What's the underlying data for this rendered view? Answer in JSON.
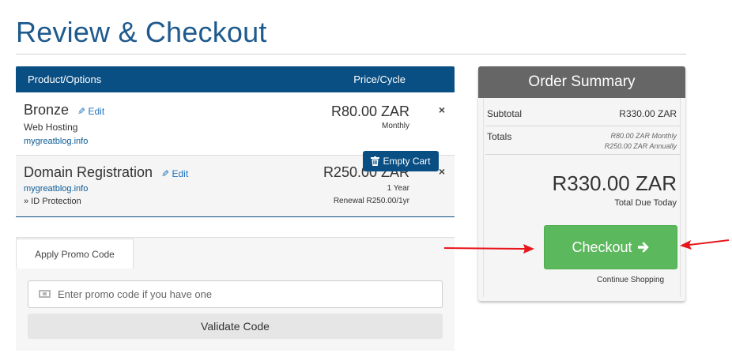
{
  "page_title": "Review & Checkout",
  "cart": {
    "header": {
      "product_col": "Product/Options",
      "price_col": "Price/Cycle"
    },
    "items": [
      {
        "name": "Bronze",
        "edit_label": "Edit",
        "subtitle": "Web Hosting",
        "domain": "mygreatblog.info",
        "price": "R80.00 ZAR",
        "cycle": "Monthly",
        "remove_label": "×"
      },
      {
        "name": "Domain Registration",
        "edit_label": "Edit",
        "domain": "mygreatblog.info",
        "option": "» ID Protection",
        "price": "R250.00 ZAR",
        "cycle": "1 Year",
        "renewal": "Renewal R250.00/1yr",
        "remove_label": "×"
      }
    ],
    "empty_cart_label": "Empty Cart"
  },
  "promo": {
    "tab_label": "Apply Promo Code",
    "input_placeholder": "Enter promo code if you have one",
    "input_value": "",
    "validate_label": "Validate Code"
  },
  "summary": {
    "title": "Order Summary",
    "subtotal_label": "Subtotal",
    "subtotal_value": "R330.00 ZAR",
    "totals_label": "Totals",
    "totals_monthly": "R80.00 ZAR Monthly",
    "totals_annually": "R250.00 ZAR Annually",
    "total_due": "R330.00 ZAR",
    "total_due_label": "Total Due Today",
    "checkout_label": "Checkout",
    "continue_label": "Continue Shopping"
  },
  "colors": {
    "primary": "#0a4f84",
    "title": "#1e5a8d",
    "checkout": "#5cb85c",
    "summary_header": "#666666",
    "annotation_arrow": "#e8161b"
  },
  "icons": {
    "edit": "pencil-icon",
    "remove": "close-icon",
    "empty_cart": "trash-icon",
    "promo": "ticket-icon",
    "checkout": "arrow-right-icon"
  }
}
